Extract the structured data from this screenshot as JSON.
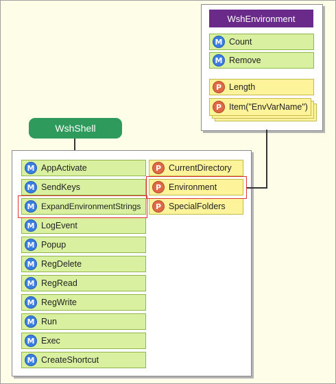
{
  "colors": {
    "background": "#fefee8",
    "shell_node": "#2e9a5c",
    "env_title": "#6a2a8a",
    "method_fill": "#d8f0a0",
    "property_fill": "#fcf39a",
    "method_badge": "#3a7ee0",
    "property_badge": "#e06a45",
    "highlight": "#e03030"
  },
  "badges": {
    "method": "M",
    "property": "P"
  },
  "wshshell": {
    "title": "WshShell",
    "methods": [
      "AppActivate",
      "SendKeys",
      "ExpandEnvironmentStrings",
      "LogEvent",
      "Popup",
      "RegDelete",
      "RegRead",
      "RegWrite",
      "Run",
      "Exec",
      "CreateShortcut"
    ],
    "properties": [
      "CurrentDirectory",
      "Environment",
      "SpecialFolders"
    ]
  },
  "wshenvironment": {
    "title": "WshEnvironment",
    "methods": [
      "Count",
      "Remove"
    ],
    "properties": [
      "Length",
      "Item(\"EnvVarName\")"
    ]
  }
}
